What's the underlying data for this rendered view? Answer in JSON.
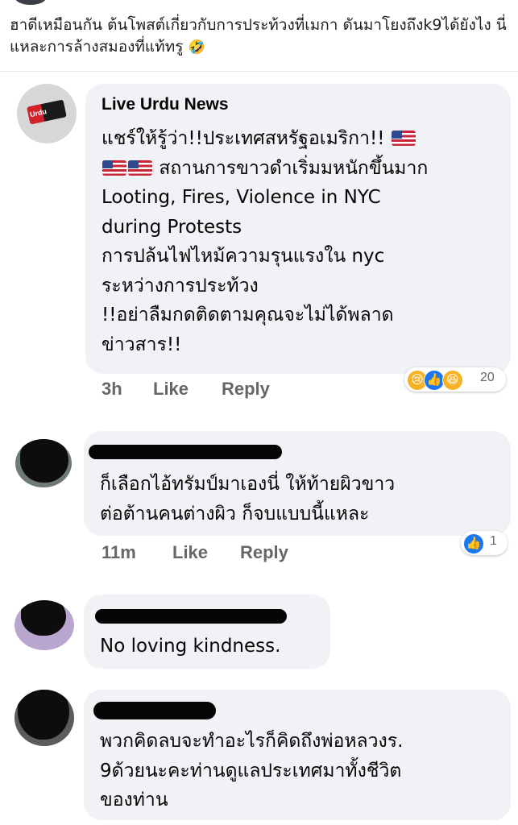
{
  "post": {
    "text": "ฮาดีเหมือนกัน ต้นโพสต์เกี่ยวกับการประท้วงที่เมกา ดันมาโยงถึงk9ได้ยังไง นี่แหละการล้างสมองที่แท้ทรู",
    "emoji": "🤣"
  },
  "comments": [
    {
      "author": "Live Urdu News",
      "lines": [
        "แชร์ให้รู้ว่า!!ประเทศสหรัฐอเมริกา!!",
        "สถานการขาวดำเริ่มมหนักขึ้นมาก",
        "Looting, Fires, Violence in NYC",
        "during Protests",
        "การปล้นไฟไหม้ความรุนแรงใน nyc",
        "ระหว่างการประท้วง",
        "!!อย่าลืมกดติดตามคุณจะไม่ได้พลาด",
        "ข่าวสาร!!"
      ],
      "time": "3h",
      "like": "Like",
      "reply": "Reply",
      "reaction_count": "20"
    },
    {
      "lines": [
        "ก็เลือกไอ้ทรัมป์มาเองนี่  ให้ท้ายผิวขาว",
        "ต่อต้านคนต่างผิว ก็จบแบบนี้แหละ"
      ],
      "time": "11m",
      "like": "Like",
      "reply": "Reply",
      "reaction_count": "1"
    },
    {
      "lines": [
        "No loving kindness."
      ]
    },
    {
      "lines": [
        "พวกคิดลบจะทำอะไรก็คิดถึงพ่อหลวงร.",
        "9ด้วยนะคะท่านดูแลประเทศมาทั้งชีวิต",
        "ของท่าน"
      ]
    }
  ],
  "logo_text": "Urdu",
  "icons": {
    "reaction_sad": "😢",
    "reaction_like": "👍",
    "reaction_haha": "😆",
    "flag": "us-flag"
  }
}
